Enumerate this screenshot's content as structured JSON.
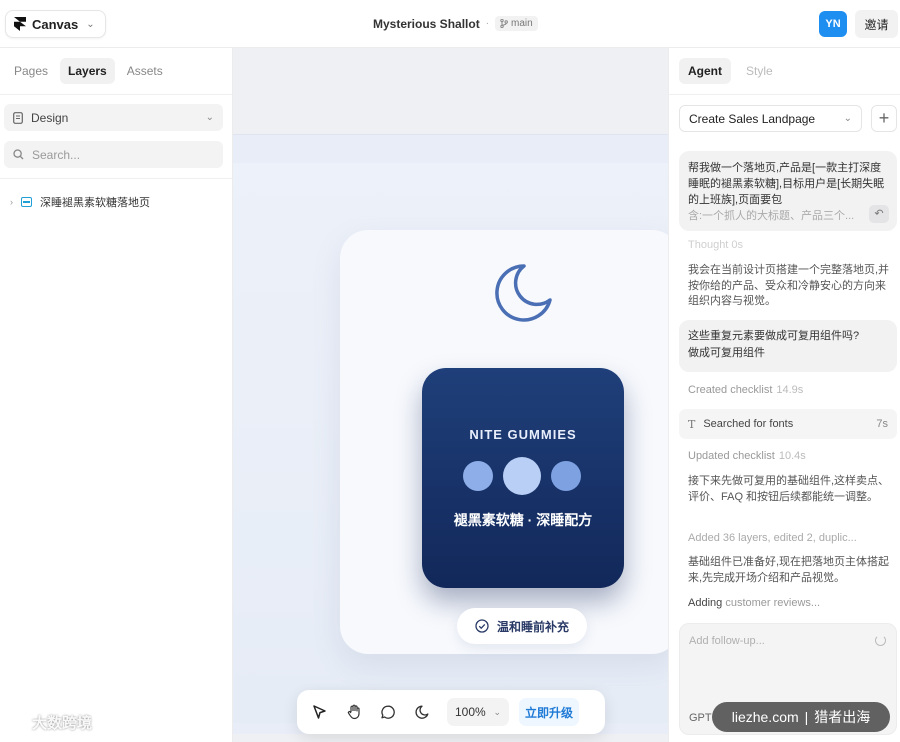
{
  "topbar": {
    "app_name": "Canvas",
    "project_title": "Mysterious Shallot",
    "branch": "main",
    "avatar_initials": "YN",
    "invite_label": "邀请"
  },
  "left_panel": {
    "tabs": [
      "Pages",
      "Layers",
      "Assets"
    ],
    "active_tab": "Layers",
    "design_select": "Design",
    "search_placeholder": "Search...",
    "layers": [
      {
        "label": "深睡褪黑素软糖落地页"
      }
    ]
  },
  "canvas": {
    "product_name": "NITE GUMMIES",
    "product_subtitle": "褪黑素软糖 · 深睡配方",
    "badge_label": "温和睡前补充",
    "zoom": "100%",
    "upgrade_label": "立即升级",
    "colors": {
      "card_dark": "#1a3468",
      "dot_light": "#a9c2f2"
    }
  },
  "right_panel": {
    "tabs": [
      "Agent",
      "Style"
    ],
    "active_tab": "Agent",
    "conversation": "Create Sales Landpage",
    "user_message": "帮我做一个落地页,产品是[一款主打深度睡眠的褪黑素软糖],目标用户是[长期失眠的上班族],页面要包",
    "user_message_faded": "含:一个抓人的大标题、产品三个...",
    "thought": "Thought 0s",
    "reply1": "我会在当前设计页搭建一个完整落地页,并按你给的产品、受众和冷静安心的方向来组织内容与视觉。",
    "question": "这些重复元素要做成可复用组件吗?",
    "answer": "做成可复用组件",
    "created_label": "Created checklist",
    "created_time": "14.9s",
    "fonts_label": "Searched for fonts",
    "fonts_time": "7s",
    "updated_label": "Updated checklist",
    "updated_time": "10.4s",
    "reply2": "接下来先做可复用的基础组件,这样卖点、评价、FAQ 和按钮后续都能统一调整。",
    "added": "Added 36 layers, edited 2, duplic...",
    "reply3": "基础组件已准备好,现在把落地页主体搭起来,先完成开场介绍和产品视觉。",
    "adding_bold": "Adding",
    "adding_rest": "customer reviews...",
    "followup_placeholder": "Add follow-up...",
    "model": "GPT"
  },
  "watermarks": {
    "left": "大数跨境",
    "right_site": "liezhe.com",
    "right_sep": "|",
    "right_text": "猎者出海"
  }
}
